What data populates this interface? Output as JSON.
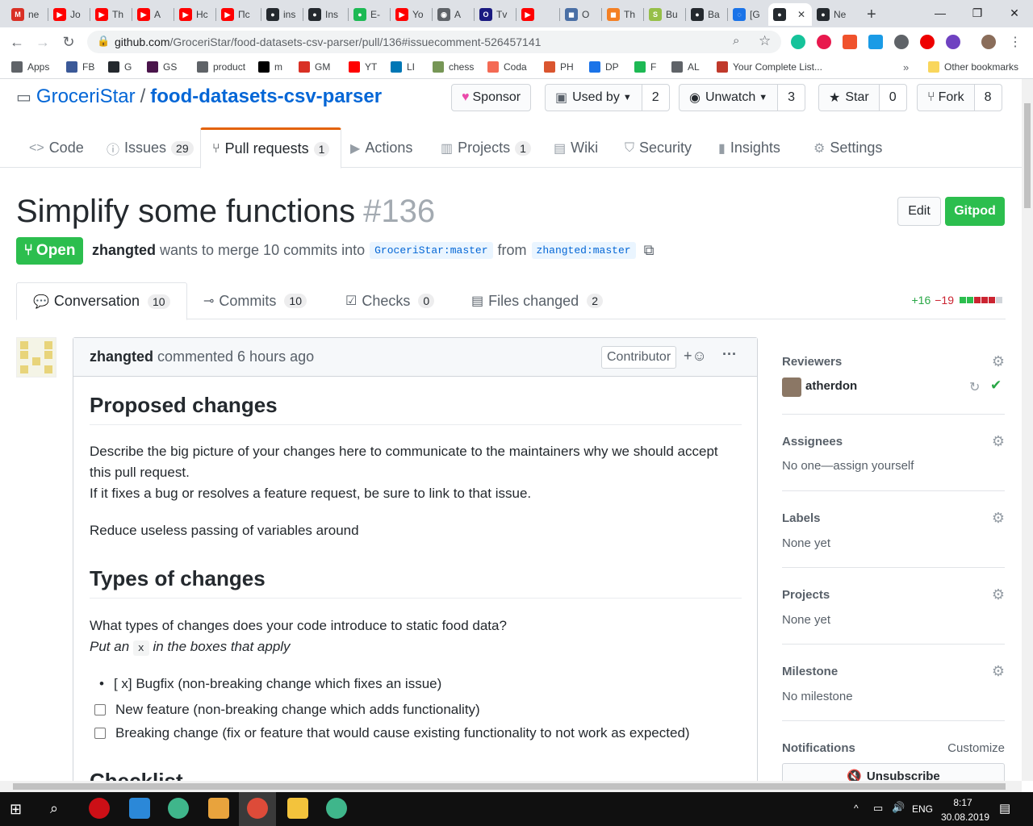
{
  "browser": {
    "tabs": [
      {
        "label": "ne",
        "color": "#d93025",
        "glyph": "M"
      },
      {
        "label": "Jo",
        "color": "#ff0000",
        "glyph": "▶"
      },
      {
        "label": "Th",
        "color": "#ff0000",
        "glyph": "▶"
      },
      {
        "label": "A",
        "color": "#ff0000",
        "glyph": "▶"
      },
      {
        "label": "Hc",
        "color": "#ff0000",
        "glyph": "▶"
      },
      {
        "label": "Пс",
        "color": "#ff0000",
        "glyph": "▶"
      },
      {
        "label": "ins",
        "color": "#24292e",
        "glyph": "●"
      },
      {
        "label": "Ins",
        "color": "#24292e",
        "glyph": "●"
      },
      {
        "label": "E-",
        "color": "#1db954",
        "glyph": "●"
      },
      {
        "label": "Yo",
        "color": "#ff0000",
        "glyph": "▶"
      },
      {
        "label": "A",
        "color": "#5f6368",
        "glyph": "◉"
      },
      {
        "label": "Tv",
        "color": "#1a1a80",
        "glyph": "O"
      },
      {
        "label": "",
        "color": "#ff0000",
        "glyph": "▶"
      },
      {
        "label": "O",
        "color": "#4a6fa5",
        "glyph": "◼"
      },
      {
        "label": "Th",
        "color": "#f48024",
        "glyph": "◼"
      },
      {
        "label": "Bu",
        "color": "#96bf48",
        "glyph": "S"
      },
      {
        "label": "Ba",
        "color": "#24292e",
        "glyph": "●"
      },
      {
        "label": "[G",
        "color": "#1a73e8",
        "glyph": "◌"
      },
      {
        "label": "",
        "color": "#24292e",
        "glyph": "●",
        "active": true
      },
      {
        "label": "Ne",
        "color": "#24292e",
        "glyph": "●"
      }
    ],
    "new_tab": "+",
    "url_host": "github.com",
    "url_path": "/GroceriStar/food-datasets-csv-parser/pull/136#issuecomment-526457141",
    "bookmarks": [
      {
        "label": "Apps",
        "color": "#5f6368"
      },
      {
        "label": "FB",
        "color": "#3b5998"
      },
      {
        "label": "G",
        "color": "#24292e"
      },
      {
        "label": "GS",
        "color": "#4a154b"
      },
      {
        "label": "product",
        "color": "#5f6368"
      },
      {
        "label": "m",
        "color": "#000000"
      },
      {
        "label": "GM",
        "color": "#d93025"
      },
      {
        "label": "YT",
        "color": "#ff0000"
      },
      {
        "label": "LI",
        "color": "#0077b5"
      },
      {
        "label": "chess",
        "color": "#769656"
      },
      {
        "label": "Coda",
        "color": "#f46a54"
      },
      {
        "label": "PH",
        "color": "#da552f"
      },
      {
        "label": "DP",
        "color": "#1a73e8"
      },
      {
        "label": "F",
        "color": "#1db954"
      },
      {
        "label": "AL",
        "color": "#5f6368"
      },
      {
        "label": "Your Complete List...",
        "color": "#c0392b"
      }
    ],
    "bookmarks_more": "»",
    "other_bookmarks": "Other bookmarks"
  },
  "repo": {
    "owner": "GroceriStar",
    "separator": "/",
    "name": "food-datasets-csv-parser",
    "sponsor_label": "Sponsor",
    "used_by_label": "Used by",
    "used_by_count": "2",
    "unwatch_label": "Unwatch",
    "watch_count": "3",
    "star_label": "Star",
    "star_count": "0",
    "fork_label": "Fork",
    "fork_count": "8"
  },
  "repo_nav": [
    {
      "label": "Code",
      "icon": "<>",
      "count": ""
    },
    {
      "label": "Issues",
      "icon": "ⓘ",
      "count": "29"
    },
    {
      "label": "Pull requests",
      "icon": "⑂",
      "count": "1"
    },
    {
      "label": "Actions",
      "icon": "▶",
      "count": ""
    },
    {
      "label": "Projects",
      "icon": "▥",
      "count": "1"
    },
    {
      "label": "Wiki",
      "icon": "▤",
      "count": ""
    },
    {
      "label": "Security",
      "icon": "⛉",
      "count": ""
    },
    {
      "label": "Insights",
      "icon": "▮",
      "count": ""
    },
    {
      "label": "Settings",
      "icon": "⚙",
      "count": ""
    }
  ],
  "pr": {
    "title": "Simplify some functions",
    "number": "#136",
    "edit_label": "Edit",
    "gitpod_label": "Gitpod",
    "state": "Open",
    "author": "zhangted",
    "meta_text": "wants to merge 10 commits into",
    "base_branch": "GroceriStar:master",
    "from_text": "from",
    "head_branch": "zhangted:master"
  },
  "pr_tabs": [
    {
      "label": "Conversation",
      "count": "10"
    },
    {
      "label": "Commits",
      "count": "10"
    },
    {
      "label": "Checks",
      "count": "0"
    },
    {
      "label": "Files changed",
      "count": "2"
    }
  ],
  "diffstat": {
    "additions": "+16",
    "deletions": "−19"
  },
  "comment": {
    "author": "zhangted",
    "action_time": "commented 6 hours ago",
    "role": "Contributor",
    "h_proposed": "Proposed changes",
    "p1": "Describe the big picture of your changes here to communicate to the maintainers why we should accept this pull request.",
    "p2": "If it fixes a bug or resolves a feature request, be sure to link to that issue.",
    "p3": "Reduce useless passing of variables around",
    "h_types": "Types of changes",
    "p4": "What types of changes does your code introduce to static food data?",
    "p5_pre": "Put an",
    "p5_code": "x",
    "p5_post": "in the boxes that apply",
    "bullet": "[ x] Bugfix (non-breaking change which fixes an issue)",
    "check1": "New feature (non-breaking change which adds functionality)",
    "check2": "Breaking change (fix or feature that would cause existing functionality to not work as expected)",
    "h_checklist": "Checklist"
  },
  "sidebar": {
    "reviewers_title": "Reviewers",
    "reviewer": "atherdon",
    "assignees_title": "Assignees",
    "assignees_value": "No one—assign yourself",
    "labels_title": "Labels",
    "labels_value": "None yet",
    "projects_title": "Projects",
    "projects_value": "None yet",
    "milestone_title": "Milestone",
    "milestone_value": "No milestone",
    "notifications_title": "Notifications",
    "customize_label": "Customize",
    "unsubscribe_label": "Unsubscribe"
  },
  "taskbar": {
    "lang": "ENG",
    "time": "8:17",
    "date": "30.08.2019"
  }
}
